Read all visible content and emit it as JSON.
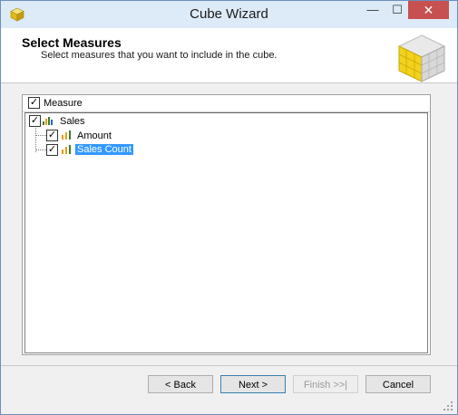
{
  "window": {
    "title": "Cube Wizard",
    "minimize_glyph": "—",
    "maximize_glyph": "☐",
    "close_glyph": "✕"
  },
  "header": {
    "title": "Select Measures",
    "subtitle": "Select measures that you want to include in the cube."
  },
  "tree": {
    "column_header": "Measure",
    "column_checked": true,
    "groups": [
      {
        "label": "Sales",
        "checked": true,
        "icon": "measure-group-icon",
        "items": [
          {
            "label": "Amount",
            "checked": true,
            "icon": "measure-icon",
            "selected": false
          },
          {
            "label": "Sales Count",
            "checked": true,
            "icon": "measure-icon",
            "selected": true
          }
        ]
      }
    ]
  },
  "buttons": {
    "back": "< Back",
    "next": "Next >",
    "finish": "Finish >>|",
    "cancel": "Cancel"
  },
  "colors": {
    "close_button": "#c75050",
    "selection": "#3399ff",
    "cube_accent": "#f2d21a"
  }
}
